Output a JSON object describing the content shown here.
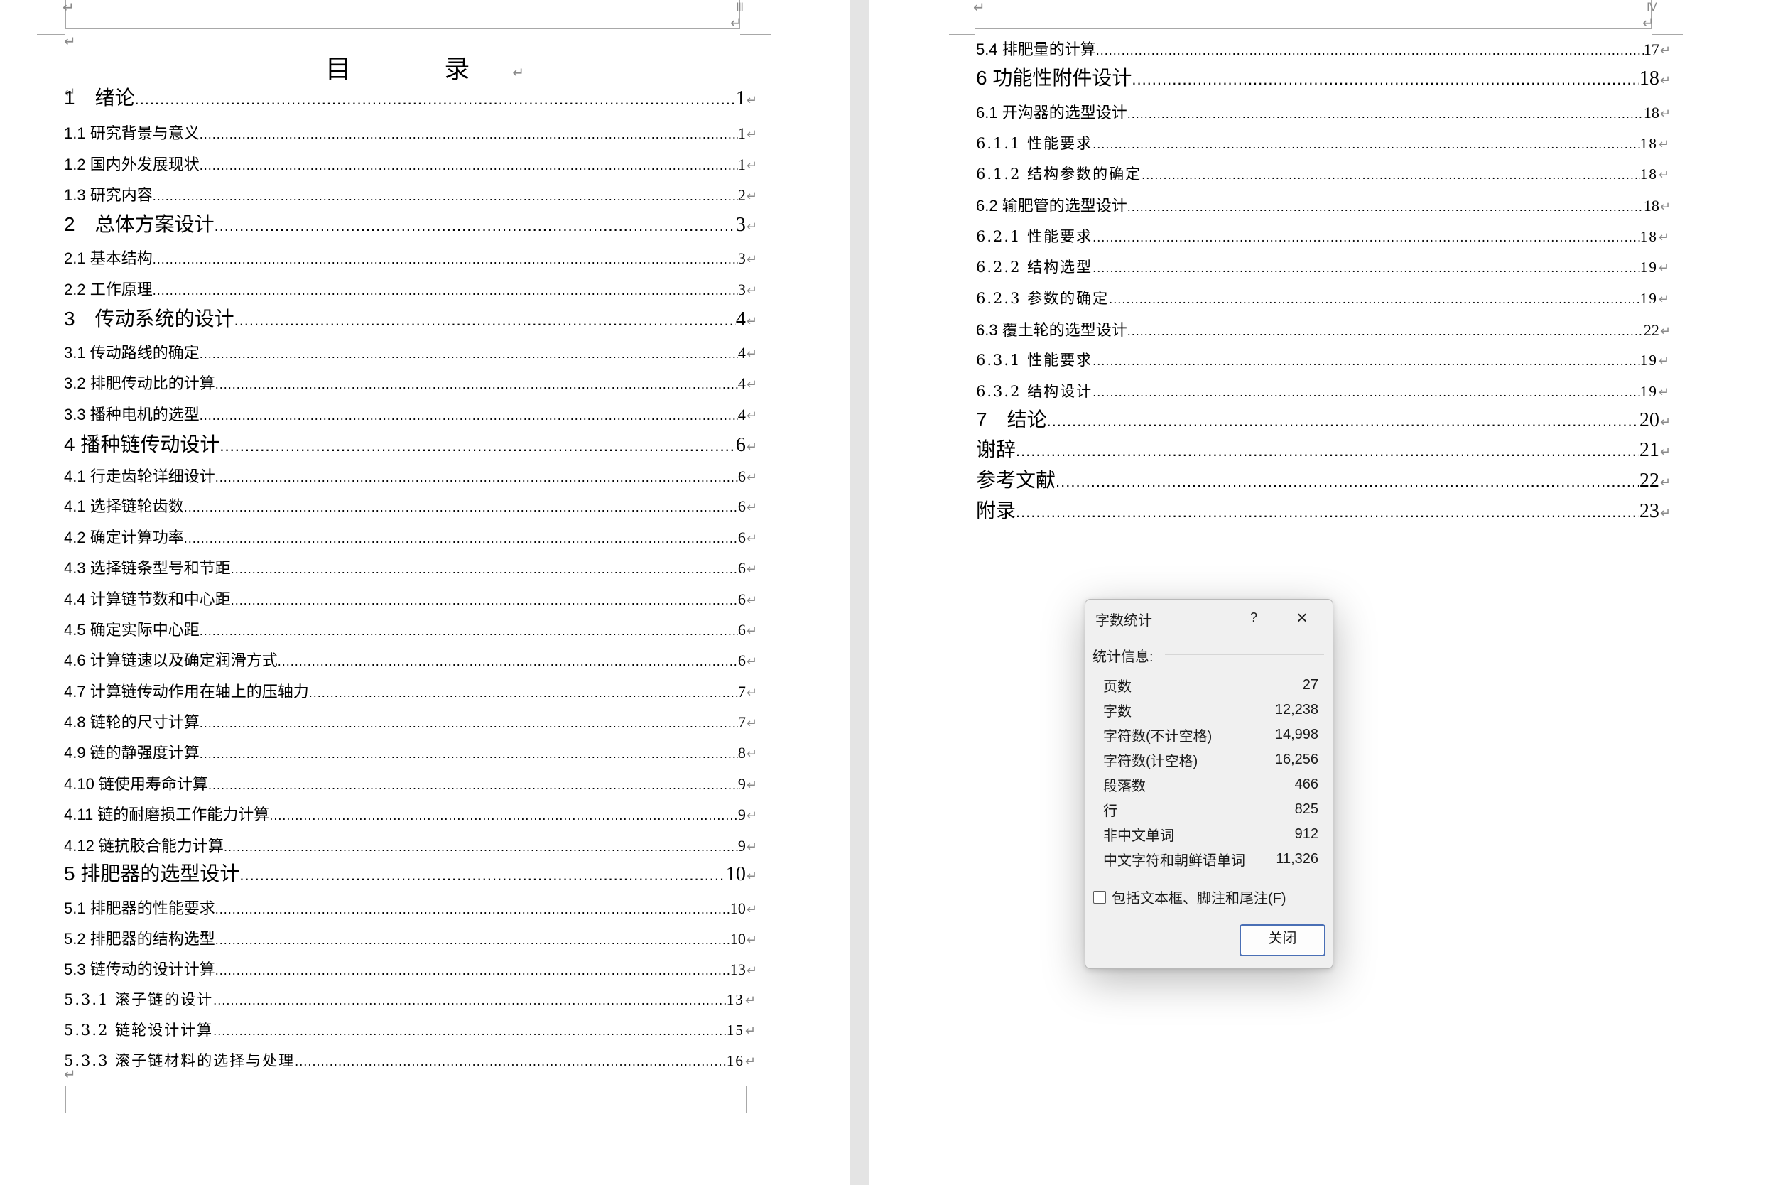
{
  "left_page": {
    "title": "目 录",
    "header_tag": "Ⅲ",
    "entries": [
      {
        "title": "1　绪论",
        "page": "1",
        "level": 1
      },
      {
        "title": "1.1  研究背景与意义",
        "page": "1",
        "level": 2
      },
      {
        "title": "1.2  国内外发展现状",
        "page": "1",
        "level": 2
      },
      {
        "title": "1.3  研究内容",
        "page": "2",
        "level": 2
      },
      {
        "title": "2　总体方案设计",
        "page": "3",
        "level": 1
      },
      {
        "title": "2.1  基本结构",
        "page": "3",
        "level": 2
      },
      {
        "title": "2.2  工作原理",
        "page": "3",
        "level": 2
      },
      {
        "title": "3　传动系统的设计",
        "page": "4",
        "level": 1
      },
      {
        "title": "3.1  传动路线的确定",
        "page": "4",
        "level": 2
      },
      {
        "title": "3.2  排肥传动比的计算",
        "page": "4",
        "level": 2
      },
      {
        "title": "3.3  播种电机的选型",
        "page": "4",
        "level": 2
      },
      {
        "title": "4 播种链传动设计",
        "page": "6",
        "level": 1
      },
      {
        "title": "4.1  行走齿轮详细设计",
        "page": "6",
        "level": 2
      },
      {
        "title": "4.1  选择链轮齿数",
        "page": "6",
        "level": 2
      },
      {
        "title": "4.2  确定计算功率",
        "page": "6",
        "level": 2
      },
      {
        "title": "4.3  选择链条型号和节距",
        "page": "6",
        "level": 2
      },
      {
        "title": "4.4  计算链节数和中心距",
        "page": "6",
        "level": 2
      },
      {
        "title": "4.5  确定实际中心距",
        "page": "6",
        "level": 2
      },
      {
        "title": "4.6  计算链速以及确定润滑方式",
        "page": "6",
        "level": 2
      },
      {
        "title": "4.7  计算链传动作用在轴上的压轴力",
        "page": "7",
        "level": 2
      },
      {
        "title": "4.8  链轮的尺寸计算",
        "page": "7",
        "level": 2
      },
      {
        "title": "4.9  链的静强度计算",
        "page": "8",
        "level": 2
      },
      {
        "title": "4.10  链使用寿命计算",
        "page": "9",
        "level": 2
      },
      {
        "title": "4.11  链的耐磨损工作能力计算",
        "page": "9",
        "level": 2
      },
      {
        "title": "4.12  链抗胶合能力计算",
        "page": "9",
        "level": 2
      },
      {
        "title": "5 排肥器的选型设计",
        "page": "10",
        "level": 1
      },
      {
        "title": "5.1  排肥器的性能要求",
        "page": "10",
        "level": 2
      },
      {
        "title": "5.2  排肥器的结构选型",
        "page": "10",
        "level": 2
      },
      {
        "title": "5.3  链传动的设计计算",
        "page": "13",
        "level": 2
      },
      {
        "title": "5.3.1 滚子链的设计",
        "page": "13",
        "level": 3
      },
      {
        "title": "5.3.2 链轮设计计算",
        "page": "15",
        "level": 3
      },
      {
        "title": "5.3.3 滚子链材料的选择与处理",
        "page": "16",
        "level": 3
      }
    ]
  },
  "right_page": {
    "header_tag": "Ⅳ",
    "entries": [
      {
        "title": "5.4  排肥量的计算",
        "page": "17",
        "level": 2
      },
      {
        "title": "6 功能性附件设计",
        "page": "18",
        "level": 1
      },
      {
        "title": "6.1  开沟器的选型设计",
        "page": "18",
        "level": 2
      },
      {
        "title": "6.1.1 性能要求",
        "page": "18",
        "level": 3
      },
      {
        "title": "6.1.2 结构参数的确定",
        "page": "18",
        "level": 3
      },
      {
        "title": "6.2  输肥管的选型设计",
        "page": "18",
        "level": 2
      },
      {
        "title": "6.2.1 性能要求",
        "page": "18",
        "level": 3
      },
      {
        "title": "6.2.2 结构选型",
        "page": "19",
        "level": 3
      },
      {
        "title": "6.2.3 参数的确定",
        "page": "19",
        "level": 3
      },
      {
        "title": "6.3  覆土轮的选型设计",
        "page": "22",
        "level": 2
      },
      {
        "title": "6.3.1 性能要求",
        "page": "19",
        "level": 3
      },
      {
        "title": "6.3.2 结构设计",
        "page": "19",
        "level": 3
      },
      {
        "title": "7　结论",
        "page": "20",
        "level": 1
      },
      {
        "title": "谢辞",
        "page": "21",
        "level": 1
      },
      {
        "title": "参考文献",
        "page": "22",
        "level": 1
      },
      {
        "title": "附录",
        "page": "23",
        "level": 1
      }
    ]
  },
  "paragraph_mark": "↵",
  "dialog": {
    "title": "字数统计",
    "help_label": "?",
    "close_icon": "×",
    "section_label": "统计信息:",
    "stats": [
      {
        "label": "页数",
        "value": "27"
      },
      {
        "label": "字数",
        "value": "12,238"
      },
      {
        "label": "字符数(不计空格)",
        "value": "14,998"
      },
      {
        "label": "字符数(计空格)",
        "value": "16,256"
      },
      {
        "label": "段落数",
        "value": "466"
      },
      {
        "label": "行",
        "value": "825"
      },
      {
        "label": "非中文单词",
        "value": "912"
      },
      {
        "label": "中文字符和朝鲜语单词",
        "value": "11,326"
      }
    ],
    "checkbox_label": "包括文本框、脚注和尾注(F)",
    "checkbox_checked": false,
    "close_button": "关闭"
  }
}
